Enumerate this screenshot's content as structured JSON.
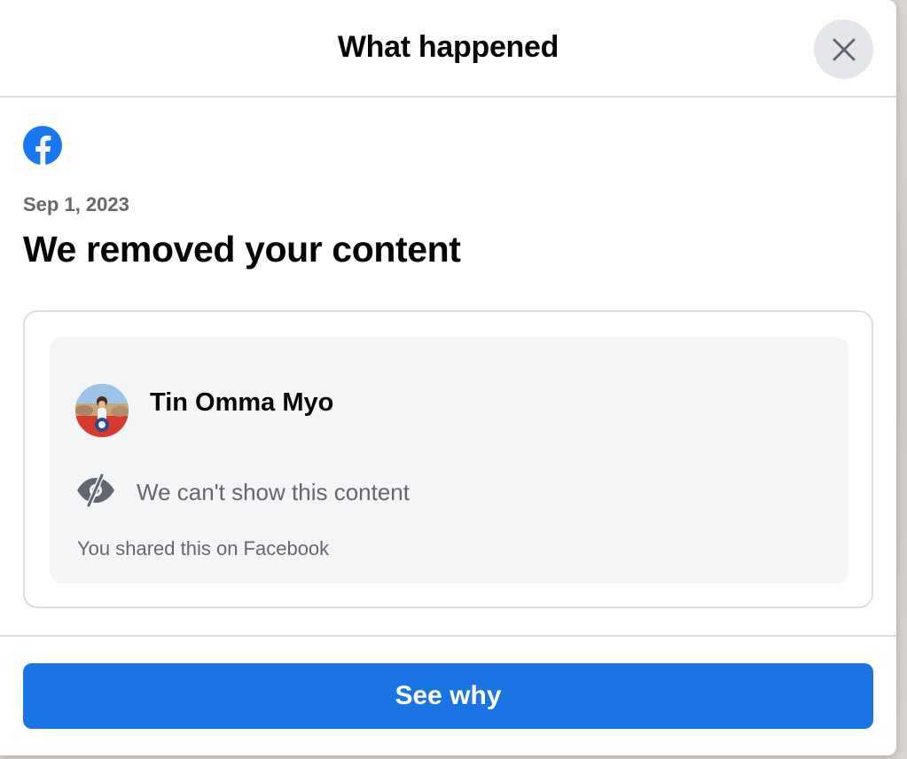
{
  "dialog": {
    "title": "What happened",
    "close_icon": "close-icon"
  },
  "notice": {
    "brand_icon": "facebook-logo-icon",
    "brand_color": "#1877f2",
    "date": "Sep 1, 2023",
    "heading": "We removed your content"
  },
  "content_preview": {
    "author_name": "Tin Omma Myo",
    "hidden_icon": "eye-slash-icon",
    "hidden_message": "We can't show this content",
    "shared_note": "You shared this on Facebook"
  },
  "footer": {
    "primary_button_label": "See why",
    "primary_button_color": "#1b74e4"
  }
}
